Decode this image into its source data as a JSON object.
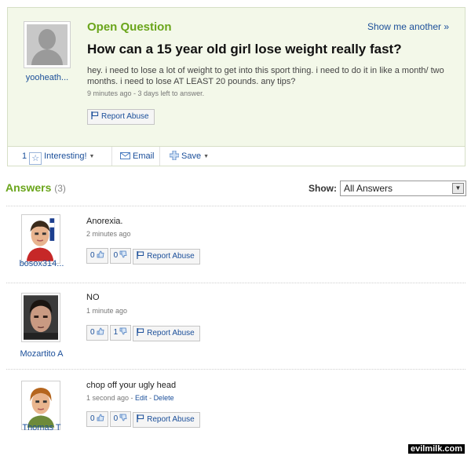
{
  "question": {
    "label": "Open Question",
    "show_another": "Show me another »",
    "title": "How can a 15 year old girl lose weight really fast?",
    "body": "hey. i need to lose a lot of weight to get into this sport thing. i need to do it in like a month/ two months. i need to lose AT LEAST 20 pounds. any tips?",
    "meta": "9 minutes ago - 3 days left to answer.",
    "report": "Report Abuse",
    "asker": "yooheath...",
    "star_count": "1",
    "interesting": "Interesting!",
    "email": "Email",
    "save": "Save"
  },
  "answers_section": {
    "title": "Answers",
    "count": "(3)",
    "show_label": "Show:",
    "show_value": "All Answers"
  },
  "answers": [
    {
      "name": "bosox314...",
      "text": "Anorexia.",
      "time": "2 minutes ago",
      "up": "0",
      "down": "0",
      "report": "Report Abuse"
    },
    {
      "name": "Mozartito A",
      "text": "NO",
      "time": "1 minute ago",
      "up": "0",
      "down": "1",
      "report": "Report Abuse"
    },
    {
      "name": "Thomas T",
      "text": "chop off your ugly head",
      "time": "1 second ago",
      "edit": "Edit",
      "sep": " - ",
      "delete": "Delete",
      "up": "0",
      "down": "0",
      "report": "Report Abuse"
    }
  ],
  "watermark": "evilmilk.com",
  "colors": {
    "accent_green": "#6aa51b",
    "link_blue": "#1a4e99",
    "question_bg": "#f3f8e9"
  }
}
